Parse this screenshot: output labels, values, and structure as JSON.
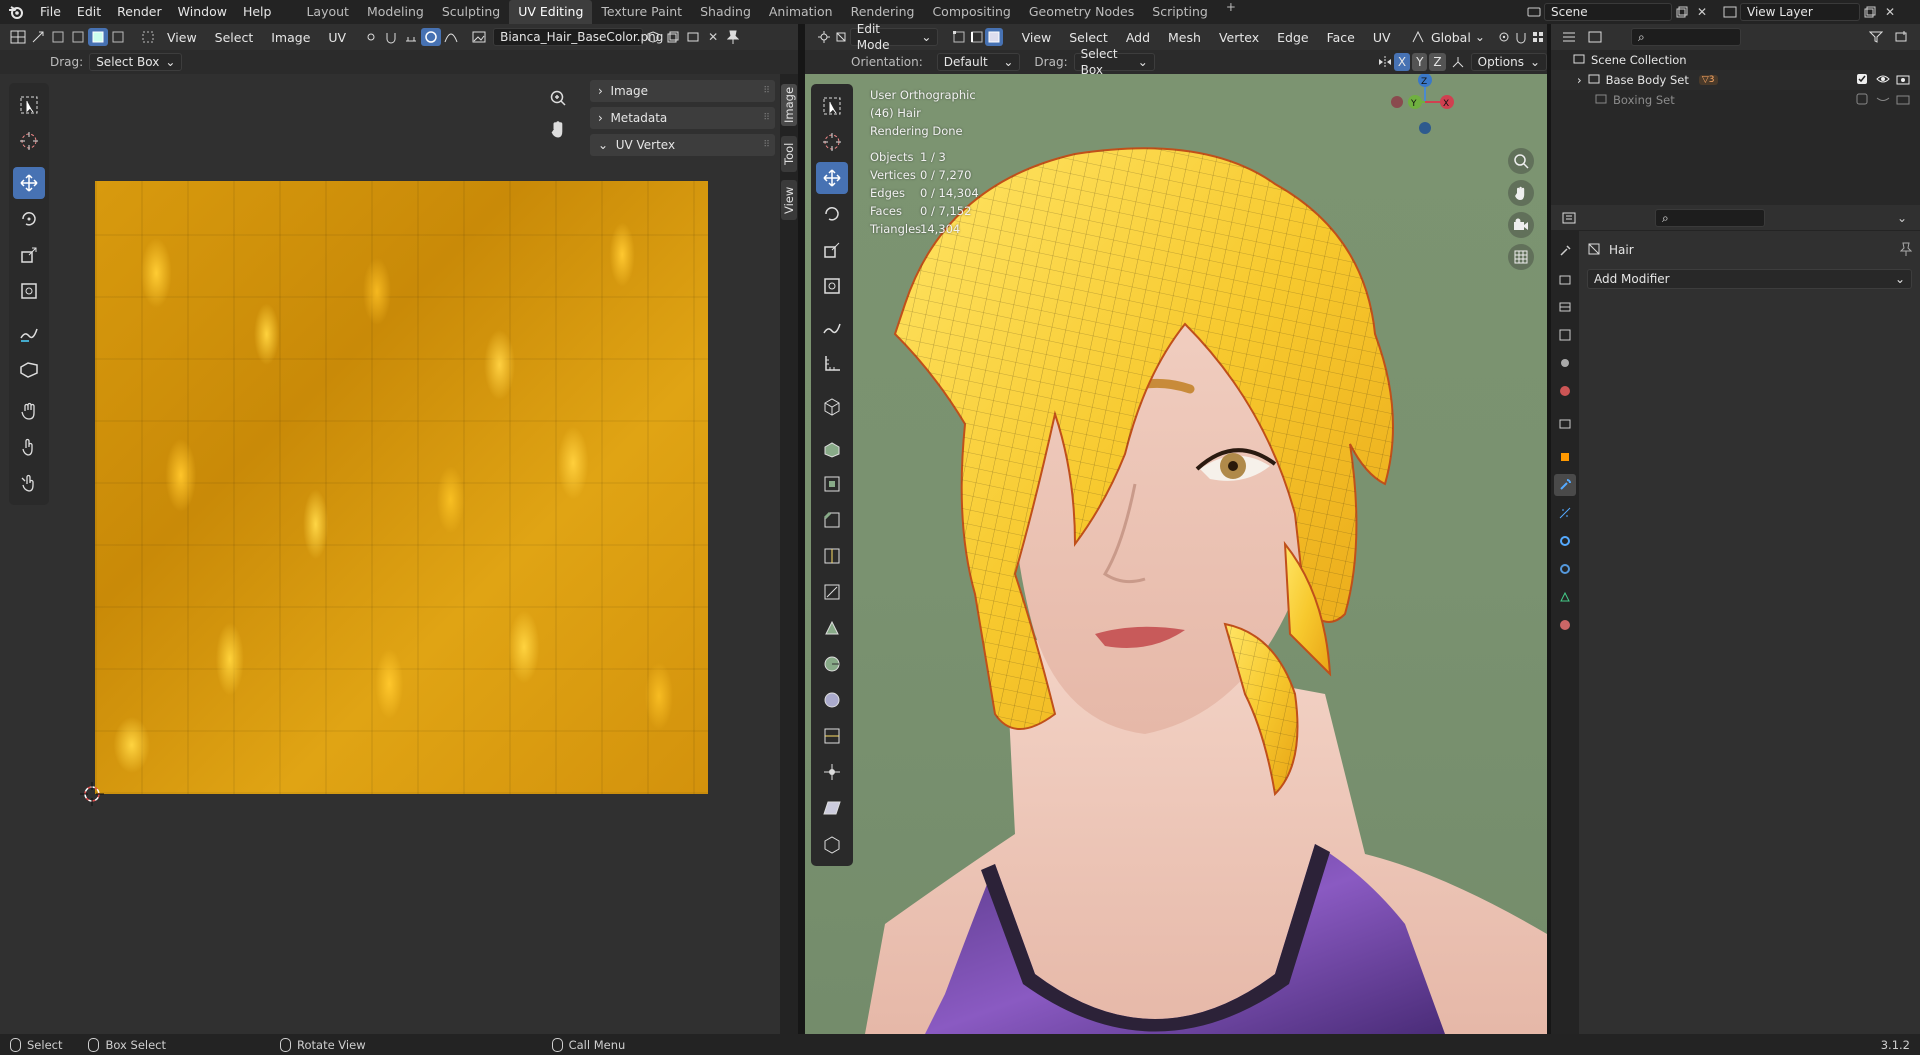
{
  "app": {
    "menus": [
      "File",
      "Edit",
      "Render",
      "Window",
      "Help"
    ],
    "workspaces": [
      "Layout",
      "Modeling",
      "Sculpting",
      "UV Editing",
      "Texture Paint",
      "Shading",
      "Animation",
      "Rendering",
      "Compositing",
      "Geometry Nodes",
      "Scripting"
    ],
    "active_workspace": "UV Editing",
    "scene_name": "Scene",
    "view_layer": "View Layer"
  },
  "uv_editor": {
    "menus": [
      "View",
      "Select",
      "Image",
      "UV"
    ],
    "image_name": "Bianca_Hair_BaseColor.png",
    "drag_label": "Drag:",
    "drag_value": "Select Box",
    "npanel": [
      "Image",
      "Metadata",
      "UV Vertex"
    ],
    "side_tabs": [
      "Image",
      "Tool",
      "View"
    ]
  },
  "viewport": {
    "mode": "Edit Mode",
    "menus": [
      "View",
      "Select",
      "Add",
      "Mesh",
      "Vertex",
      "Edge",
      "Face",
      "UV"
    ],
    "transform": "Global",
    "orientation_label": "Orientation:",
    "orientation_value": "Default",
    "drag_label": "Drag:",
    "drag_value": "Select Box",
    "options": "Options",
    "axes": [
      "X",
      "Y",
      "Z"
    ],
    "view_name": "User Orthographic",
    "object_info": "(46) Hair",
    "render_status": "Rendering Done",
    "stats": [
      {
        "k": "Objects",
        "v": "1 / 3"
      },
      {
        "k": "Vertices",
        "v": "0 / 7,270"
      },
      {
        "k": "Edges",
        "v": "0 / 14,304"
      },
      {
        "k": "Faces",
        "v": "0 / 7,152"
      },
      {
        "k": "Triangles",
        "v": "14,304"
      }
    ]
  },
  "outliner": {
    "root": "Scene Collection",
    "items": [
      "Base Body Set",
      "Boxing Set"
    ],
    "badge": "3"
  },
  "properties": {
    "object_name": "Hair",
    "add_modifier": "Add Modifier"
  },
  "statusbar": {
    "items": [
      "Select",
      "Box Select",
      "Rotate View",
      "Call Menu"
    ],
    "version": "3.1.2"
  }
}
